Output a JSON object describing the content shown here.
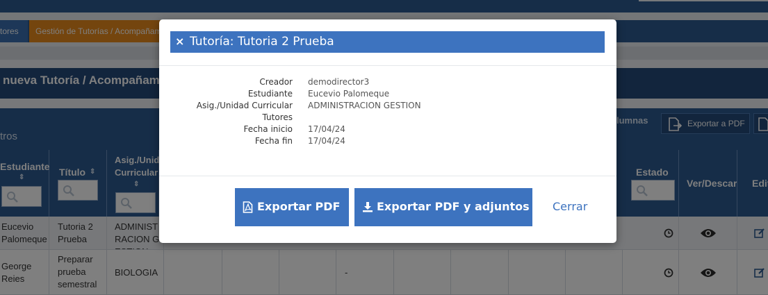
{
  "background": {
    "tabs": [
      "tores",
      "Gestión de Tutorías / Acompañamientos"
    ],
    "page_title": "nueva Tutoría / Acompañamiento",
    "filters_label": "tros",
    "columns_label": "lumnas",
    "export_pdf_label": "Exportar a PDF",
    "table": {
      "headers": [
        {
          "label": "Estudiante",
          "sort": "⇕"
        },
        {
          "label": "Título",
          "sort": "⇕"
        },
        {
          "label": "Asig./Unid Curricular",
          "sort": "⇕"
        },
        {
          "label": "Estado",
          "sort": ""
        },
        {
          "label": "Ver/Descargar",
          "sort": ""
        },
        {
          "label": "Editar",
          "sort": ""
        }
      ],
      "rows": [
        {
          "estudiante": "Eucevio Palomeque",
          "titulo": "Tutoria 2 Prueba",
          "asig": "ADMINISTRACION GESTION",
          "dash": ""
        },
        {
          "estudiante": "George Reies",
          "titulo": "Preparar prueba semestral",
          "asig": "BIOLOGIA",
          "dash": "-"
        }
      ]
    }
  },
  "modal": {
    "title": "Tutoría: Tutoria 2 Prueba",
    "close_symbol": "×",
    "fields": [
      {
        "label": "Creador",
        "value": "demodirector3"
      },
      {
        "label": "Estudiante",
        "value": "Eucevio Palomeque"
      },
      {
        "label": "Asig./Unidad Curricular",
        "value": "ADMINISTRACION GESTION"
      },
      {
        "label": "Tutores",
        "value": ""
      },
      {
        "label": "Fecha inicio",
        "value": "17/04/24"
      },
      {
        "label": "Fecha fin",
        "value": "17/04/24"
      }
    ],
    "buttons": {
      "export_pdf": "Exportar PDF",
      "export_pdf_attachments": "Exportar PDF y adjuntos",
      "close": "Cerrar"
    }
  },
  "colors": {
    "primary": "#3d73bf",
    "navy": "#2d5a91",
    "orange_tab": "#e98a1c",
    "overlay": "rgba(0,0,0,0.5)"
  }
}
